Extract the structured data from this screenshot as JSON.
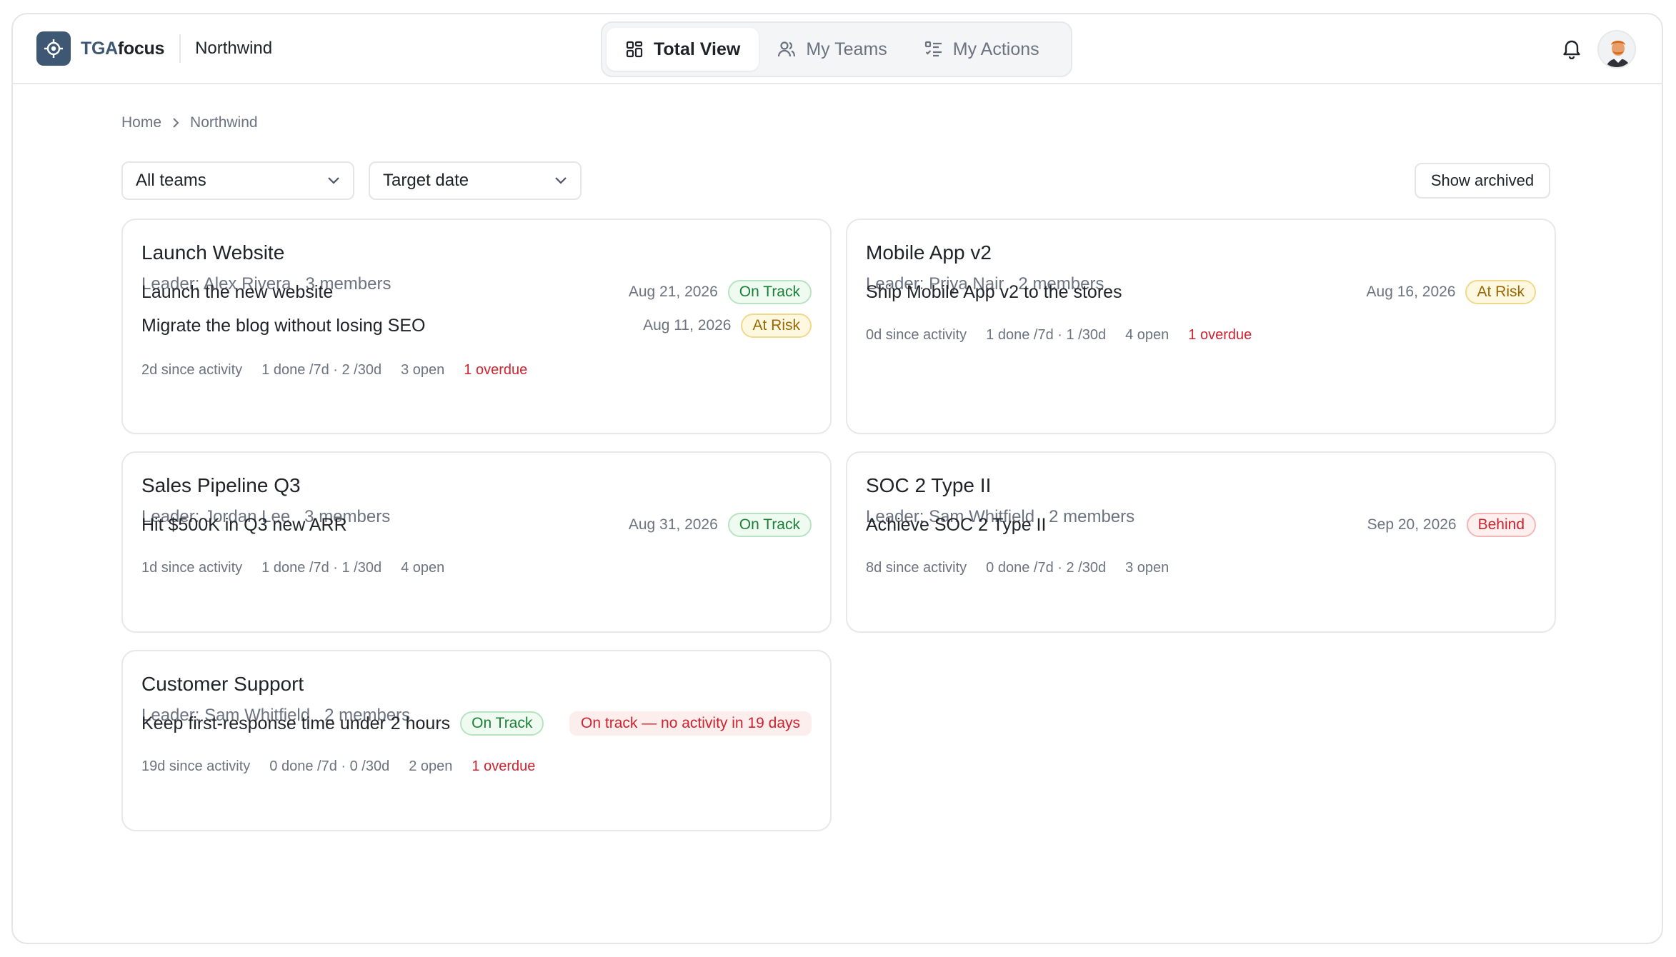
{
  "header": {
    "brand_prefix": "TGA",
    "brand_suffix": "focus",
    "org": "Northwind",
    "tabs": [
      {
        "label": "Total View",
        "icon": "grid-icon",
        "active": true
      },
      {
        "label": "My Teams",
        "icon": "users-icon",
        "active": false
      },
      {
        "label": "My Actions",
        "icon": "checklist-icon",
        "active": false
      }
    ],
    "bell_icon": "bell-icon",
    "avatar_icon": "user-avatar"
  },
  "breadcrumb": {
    "home": "Home",
    "current": "Northwind"
  },
  "filters": {
    "teams": "All teams",
    "sort": "Target date",
    "show_archived": "Show archived"
  },
  "cards": [
    {
      "title": "Launch Website",
      "leader": "Leader: Alex Rivera",
      "members": "3 members",
      "goals": [
        {
          "title": "Launch the new website",
          "date": "Aug 21, 2026",
          "status": "On Track"
        },
        {
          "title": "Migrate the blog without losing SEO",
          "date": "Aug 11, 2026",
          "status": "At Risk"
        }
      ],
      "stats": {
        "activity": "2d since activity",
        "done": "1 done /7d · 2 /30d",
        "open": "3 open",
        "overdue": "1 overdue"
      }
    },
    {
      "title": "Mobile App v2",
      "leader": "Leader: Priya Nair",
      "members": "2 members",
      "goals": [
        {
          "title": "Ship Mobile App v2 to the stores",
          "date": "Aug 16, 2026",
          "status": "At Risk"
        }
      ],
      "stats": {
        "activity": "0d since activity",
        "done": "1 done /7d · 1 /30d",
        "open": "4 open",
        "overdue": "1 overdue"
      }
    },
    {
      "title": "Sales Pipeline Q3",
      "leader": "Leader: Jordan Lee",
      "members": "3 members",
      "goals": [
        {
          "title": "Hit $500K in Q3 new ARR",
          "date": "Aug 31, 2026",
          "status": "On Track"
        }
      ],
      "stats": {
        "activity": "1d since activity",
        "done": "1 done /7d · 1 /30d",
        "open": "4 open"
      }
    },
    {
      "title": "SOC 2 Type II",
      "leader": "Leader: Sam Whitfield",
      "members": "2 members",
      "goals": [
        {
          "title": "Achieve SOC 2 Type II",
          "date": "Sep 20, 2026",
          "status": "Behind"
        }
      ],
      "stats": {
        "activity": "8d since activity",
        "done": "0 done /7d · 2 /30d",
        "open": "3 open"
      }
    },
    {
      "title": "Customer Support",
      "leader": "Leader: Sam Whitfield",
      "members": "2 members",
      "goals": [
        {
          "title": "Keep first-response time under 2 hours",
          "status": "On Track",
          "warning": "On track — no activity in 19 days"
        }
      ],
      "stats": {
        "activity": "19d since activity",
        "done": "0 done /7d · 0 /30d",
        "open": "2 open",
        "overdue": "1 overdue"
      }
    }
  ],
  "colors": {
    "brand": "#3e5873",
    "on_track": "#1a7f37",
    "at_risk": "#9a6700",
    "behind": "#cf222e"
  }
}
